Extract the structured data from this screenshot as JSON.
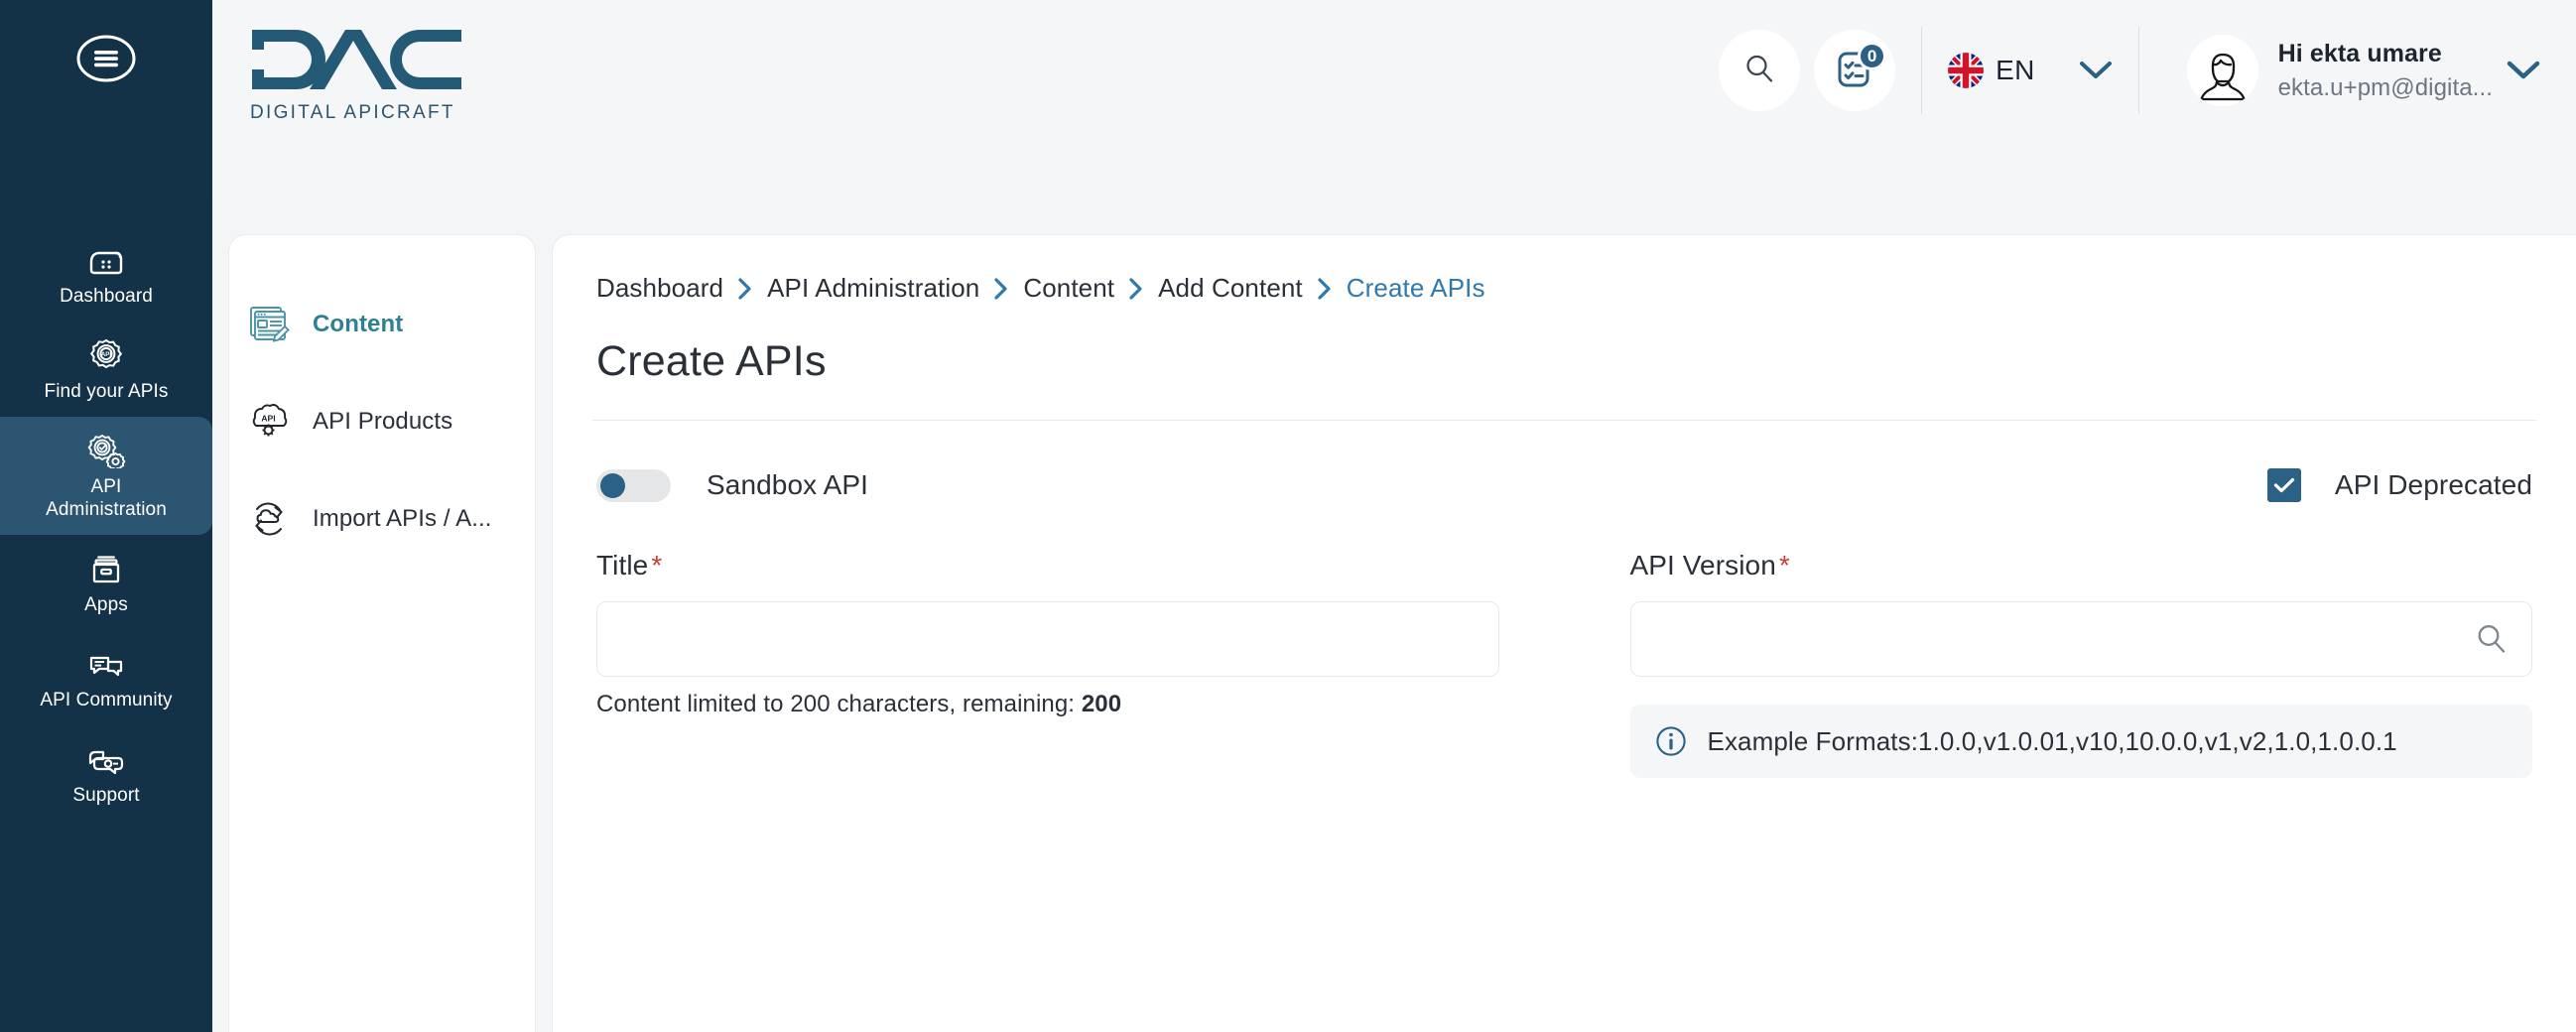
{
  "brand": {
    "logo_text": "DAC",
    "tagline": "DIGITAL APICRAFT"
  },
  "colors": {
    "rail_bg": "#133247",
    "rail_active_bg": "#2b5571",
    "accent_blue": "#2c6186",
    "link_blue": "#2f79ad",
    "teal": "#2f7f95",
    "required_red": "#cf3b35",
    "page_bg": "#f4f5f6"
  },
  "topbar": {
    "menu_toggle": "hamburger-menu",
    "search_label": "Search",
    "tasks_badge": "0",
    "language": {
      "code": "EN",
      "flag": "uk-flag"
    },
    "user": {
      "greeting": "Hi ekta umare",
      "email": "ekta.u+pm@digita..."
    }
  },
  "rail": {
    "items": [
      {
        "label": "Dashboard",
        "icon": "dashboard-icon",
        "active": false
      },
      {
        "label": "Find your APIs",
        "icon": "find-apis-icon",
        "active": false
      },
      {
        "label": "API\nAdministration",
        "icon": "api-administration-icon",
        "active": true
      },
      {
        "label": "Apps",
        "icon": "apps-icon",
        "active": false
      },
      {
        "label": "API Community",
        "icon": "api-community-icon",
        "active": false
      },
      {
        "label": "Support",
        "icon": "support-icon",
        "active": false
      }
    ]
  },
  "subsidebar": {
    "items": [
      {
        "label": "Content",
        "icon": "content-icon",
        "active": true
      },
      {
        "label": "API Products",
        "icon": "api-products-icon",
        "active": false
      },
      {
        "label": "Import APIs / A...",
        "icon": "import-apis-icon",
        "active": false
      }
    ]
  },
  "breadcrumb": {
    "items": [
      {
        "label": "Dashboard",
        "current": false
      },
      {
        "label": "API Administration",
        "current": false
      },
      {
        "label": "Content",
        "current": false
      },
      {
        "label": "Add Content",
        "current": false
      },
      {
        "label": "Create APIs",
        "current": true
      }
    ]
  },
  "main": {
    "title": "Create APIs",
    "sandbox": {
      "label": "Sandbox API",
      "enabled": false
    },
    "deprecated": {
      "label": "API Deprecated",
      "checked": true
    },
    "title_field": {
      "label": "Title",
      "required_marker": "*",
      "value": "",
      "placeholder": "",
      "helper_prefix": "Content limited to 200 characters, remaining: ",
      "helper_remaining": "200"
    },
    "version_field": {
      "label": "API Version",
      "required_marker": "*",
      "value": "",
      "placeholder": "",
      "search_icon": "search-icon",
      "info_icon": "info-icon",
      "info_text": "Example Formats:1.0.0,v1.0.01,v10,10.0.0,v1,v2,1.0,1.0.0.1"
    }
  }
}
